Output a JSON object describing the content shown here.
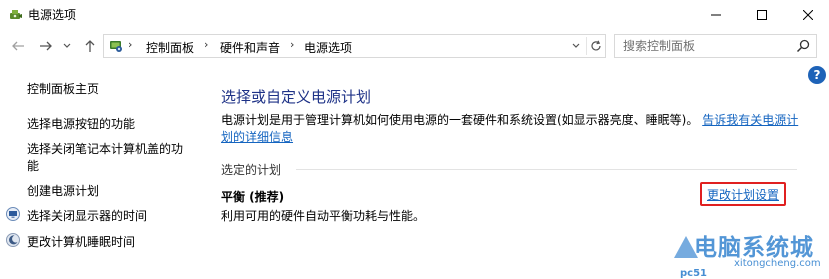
{
  "window": {
    "title": "电源选项",
    "app_icon": "power-options-icon"
  },
  "address": {
    "icon": "control-panel-icon",
    "breadcrumbs": [
      "控制面板",
      "硬件和声音",
      "电源选项"
    ]
  },
  "search": {
    "placeholder": "搜索控制面板",
    "value": ""
  },
  "help": {
    "label": "?"
  },
  "sidebar": {
    "items": [
      {
        "label": "控制面板主页",
        "icon": ""
      },
      {
        "label": "选择电源按钮的功能",
        "icon": ""
      },
      {
        "label": "选择关闭笔记本计算机盖的功",
        "icon": ""
      },
      {
        "label": "能",
        "icon": ""
      },
      {
        "label": "创建电源计划",
        "icon": ""
      },
      {
        "label": "选择关闭显示器的时间",
        "icon": "monitor-icon"
      },
      {
        "label": "更改计算机睡眠时间",
        "icon": "moon-icon"
      }
    ]
  },
  "main": {
    "heading": "选择或自定义电源计划",
    "description_text": "电源计划是用于管理计算机如何使用电源的一套硬件和系统设置(如显示器亮度、睡眠等)。",
    "description_link": "告诉我有关电源计划的详细信息",
    "selected_plan_label": "选定的计划",
    "plan_name": "平衡 (推荐)",
    "plan_description": "利用可用的硬件自动平衡功耗与性能。",
    "change_plan_link": "更改计划设置"
  },
  "watermark": {
    "big": "电脑系统城",
    "small": "xitongcheng.com",
    "pc": "pc51"
  },
  "colors": {
    "heading": "#1e3287",
    "link": "#1565c0",
    "highlight_box": "#e02020",
    "help": "#1e63b8"
  }
}
